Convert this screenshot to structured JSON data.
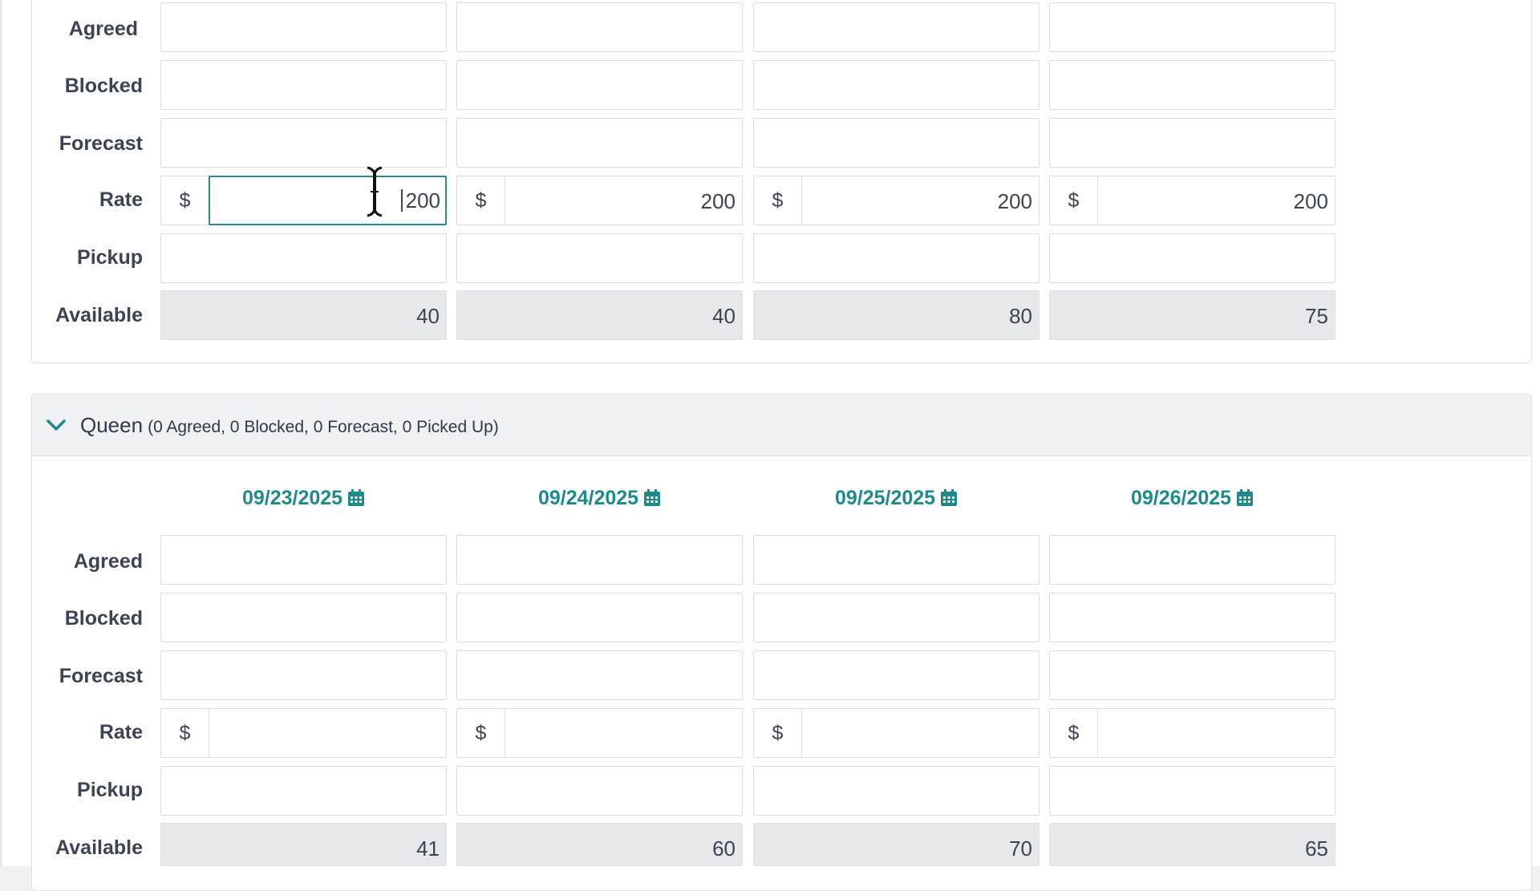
{
  "rows": {
    "agreed": "Agreed",
    "blocked": "Blocked",
    "forecast": "Forecast",
    "rate": "Rate",
    "pickup": "Pickup",
    "available": "Available"
  },
  "currency_symbol": "$",
  "top_section": {
    "rates": [
      "200",
      "200",
      "200",
      "200"
    ],
    "available": [
      "40",
      "40",
      "80",
      "75"
    ]
  },
  "queen_section": {
    "title": "Queen",
    "summary": "(0 Agreed, 0 Blocked, 0 Forecast, 0 Picked Up)",
    "dates": [
      "09/23/2025",
      "09/24/2025",
      "09/25/2025",
      "09/26/2025"
    ],
    "rates": [
      "",
      "",
      "",
      ""
    ],
    "available": [
      "41",
      "60",
      "70",
      "65"
    ]
  },
  "icons": {
    "calendar": "calendar-icon",
    "chevron": "chevron-down-icon",
    "cursor": "text-cursor-icon"
  },
  "colors": {
    "accent": "#1f8a8c",
    "focus": "#2a8a8e",
    "readonly_bg": "#e7e8ea"
  }
}
